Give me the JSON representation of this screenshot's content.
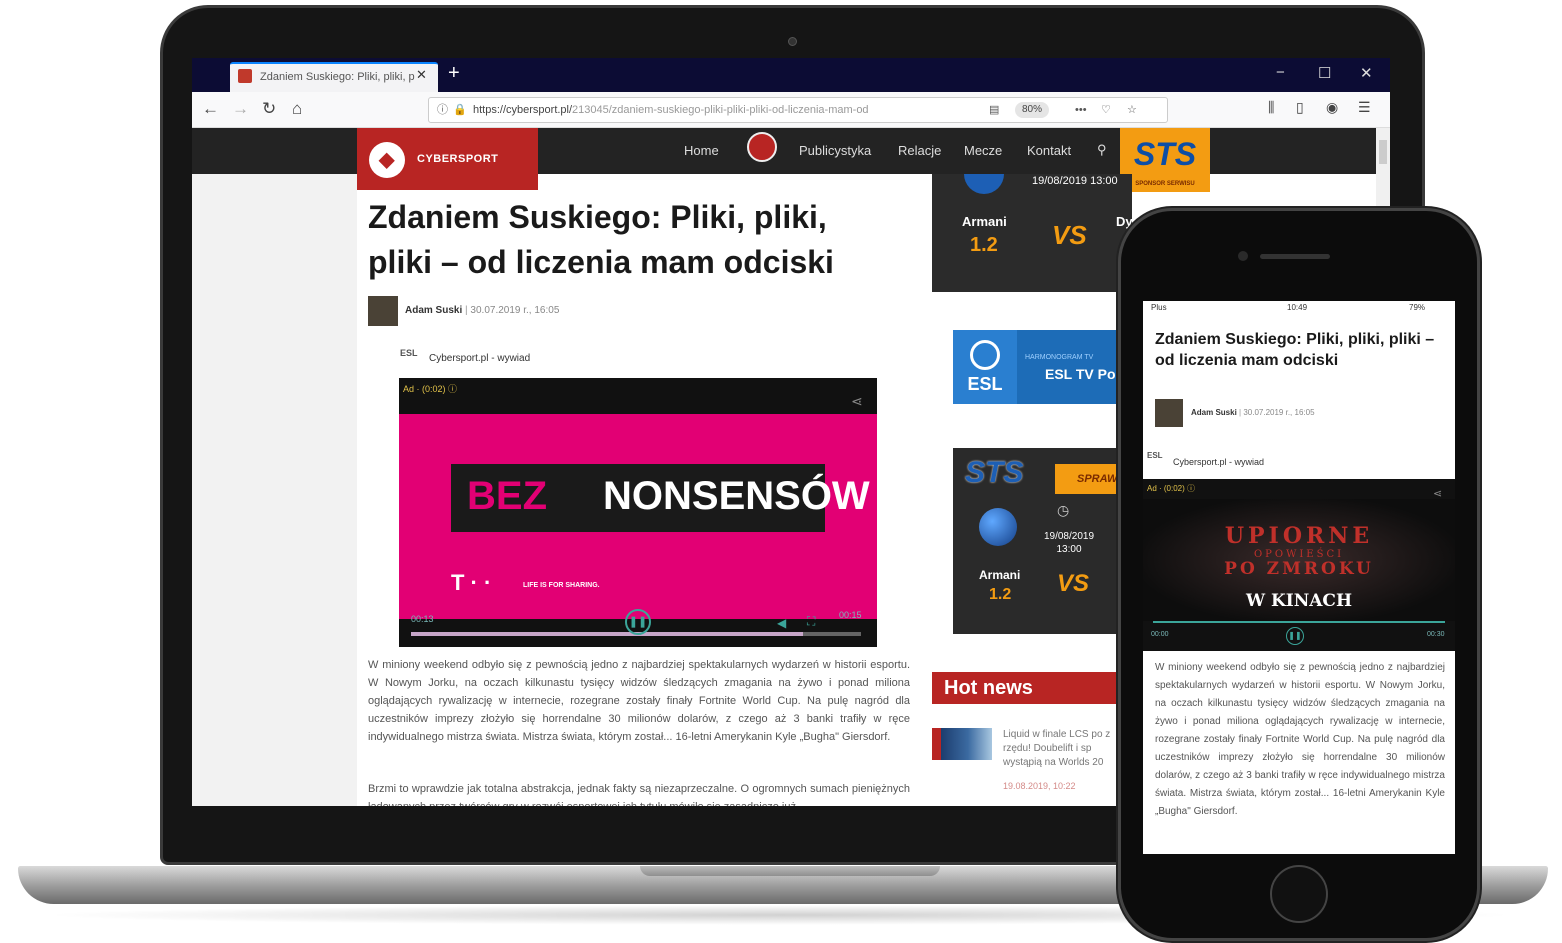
{
  "browser": {
    "tab_title": "Zdaniem Suskiego: Pliki, pliki, p",
    "tab_close": "✕",
    "new_tab": "+",
    "url_host": "https://cybersport.pl/",
    "url_path": "213045/zdaniem-suskiego-pliki-pliki-pliki-od-liczenia-mam-od",
    "zoom": "80%",
    "window_controls": [
      "−",
      "☐",
      "✕"
    ],
    "nav_icons": [
      "back-icon",
      "forward-icon",
      "reload-icon",
      "home-icon"
    ]
  },
  "site": {
    "logo_text": "CYBERSPORT",
    "menu": [
      "Home",
      "Publicystyka",
      "Relacje",
      "Mecze",
      "Kontakt"
    ],
    "sponsor": "STS",
    "sponsor_sub": "SPONSOR SERWISU"
  },
  "article": {
    "title": "Zdaniem Suskiego: Pliki, pliki, pliki – od liczenia mam odciski",
    "author": "Adam Suski",
    "separator": "|",
    "date": "30.07.2019 r., 16:05",
    "video_logo": "ESL",
    "video_source": "Cybersport.pl - wywiad",
    "video": {
      "ad_label": "Ad · (0:02)  ⓘ",
      "headline_red": "BEZ",
      "headline_white": "NONSENSÓW",
      "brand": "T · ·",
      "claim": "LIFE IS FOR SHARING.",
      "time_current": "00:13",
      "time_total": "00:15",
      "progress": 0.87
    },
    "paragraph1": "W miniony weekend odbyło się z pewnością jedno z najbardziej spektakularnych wydarzeń w historii esportu. W Nowym Jorku, na oczach kilkunastu tysięcy widzów śledzących zmagania na żywo i ponad miliona oglądających rywalizację w internecie, rozegrane zostały finały Fortnite World Cup. Na pulę nagród dla uczestników imprezy złożyło się horrendalne 30 milionów dolarów, z czego aż 3 banki trafiły w ręce indywidualnego mistrza świata. Mistrza świata, którym został... 16-letni Amerykanin Kyle „Bugha\" Giersdorf.",
    "paragraph2": "Brzmi to wprawdzie jak totalna abstrakcja, jednak fakty są niezaprzeczalne. O ogromnych sumach pieniężnych ładowanych przez twórców gry w rozwój esportowej ich tytułu mówiło się zasadniczo już"
  },
  "sidebar": {
    "ad_top": {
      "date": "19/08/2019 13:00",
      "team1": "Armani",
      "odds1": "1.2",
      "vs": "VS",
      "team2": "Dy"
    },
    "esl_ad": {
      "logo": "ESL",
      "kicker": "HARMONOGRAM TV",
      "title": "ESL TV Po"
    },
    "sts_ad": {
      "logo": "STS",
      "button": "SPRAWD",
      "date": "19/08/2019 13:00",
      "team1": "Armani",
      "odds1": "1.2",
      "vs": "VS",
      "team2": "Dy"
    },
    "hot_news_title": "Hot news",
    "news": {
      "text": "Liquid w finale LCS po z rzędu! Doubelift i sp wystąpią na Worlds 20",
      "date": "19.08.2019, 10:22"
    }
  },
  "phone": {
    "status_carrier": "Plus",
    "status_time": "10:49",
    "status_battery": "79%",
    "title": "Zdaniem Suskiego: Pliki, pliki, pliki – od liczenia mam odciski",
    "author": "Adam Suski",
    "separator": "|",
    "date": "30.07.2019 r., 16:05",
    "video_logo": "ESL",
    "video_source": "Cybersport.pl - wywiad",
    "video": {
      "ad_label": "Ad · (0:02)  ⓘ",
      "line1": "UPIORNE",
      "line2": "OPOWIEŚCI",
      "line3": "PO ZMROKU",
      "line4": "W KINACH",
      "time_current": "00:00",
      "time_total": "00:30"
    },
    "paragraph": "W miniony weekend odbyło się z pewnością jedno z najbardziej spektakularnych wydarzeń w historii esportu. W Nowym Jorku, na oczach kilkunastu tysięcy widzów śledzących zmagania na żywo i ponad miliona oglądających rywalizację w internecie, rozegrane zostały finały Fortnite World Cup. Na pulę nagród dla uczestników imprezy złożyło się horrendalne 30 milionów dolarów, z czego aż 3 banki trafiły w ręce indywidualnego mistrza świata. Mistrza świata, którym został... 16-letni Amerykanin Kyle „Bugha\" Giersdorf."
  }
}
